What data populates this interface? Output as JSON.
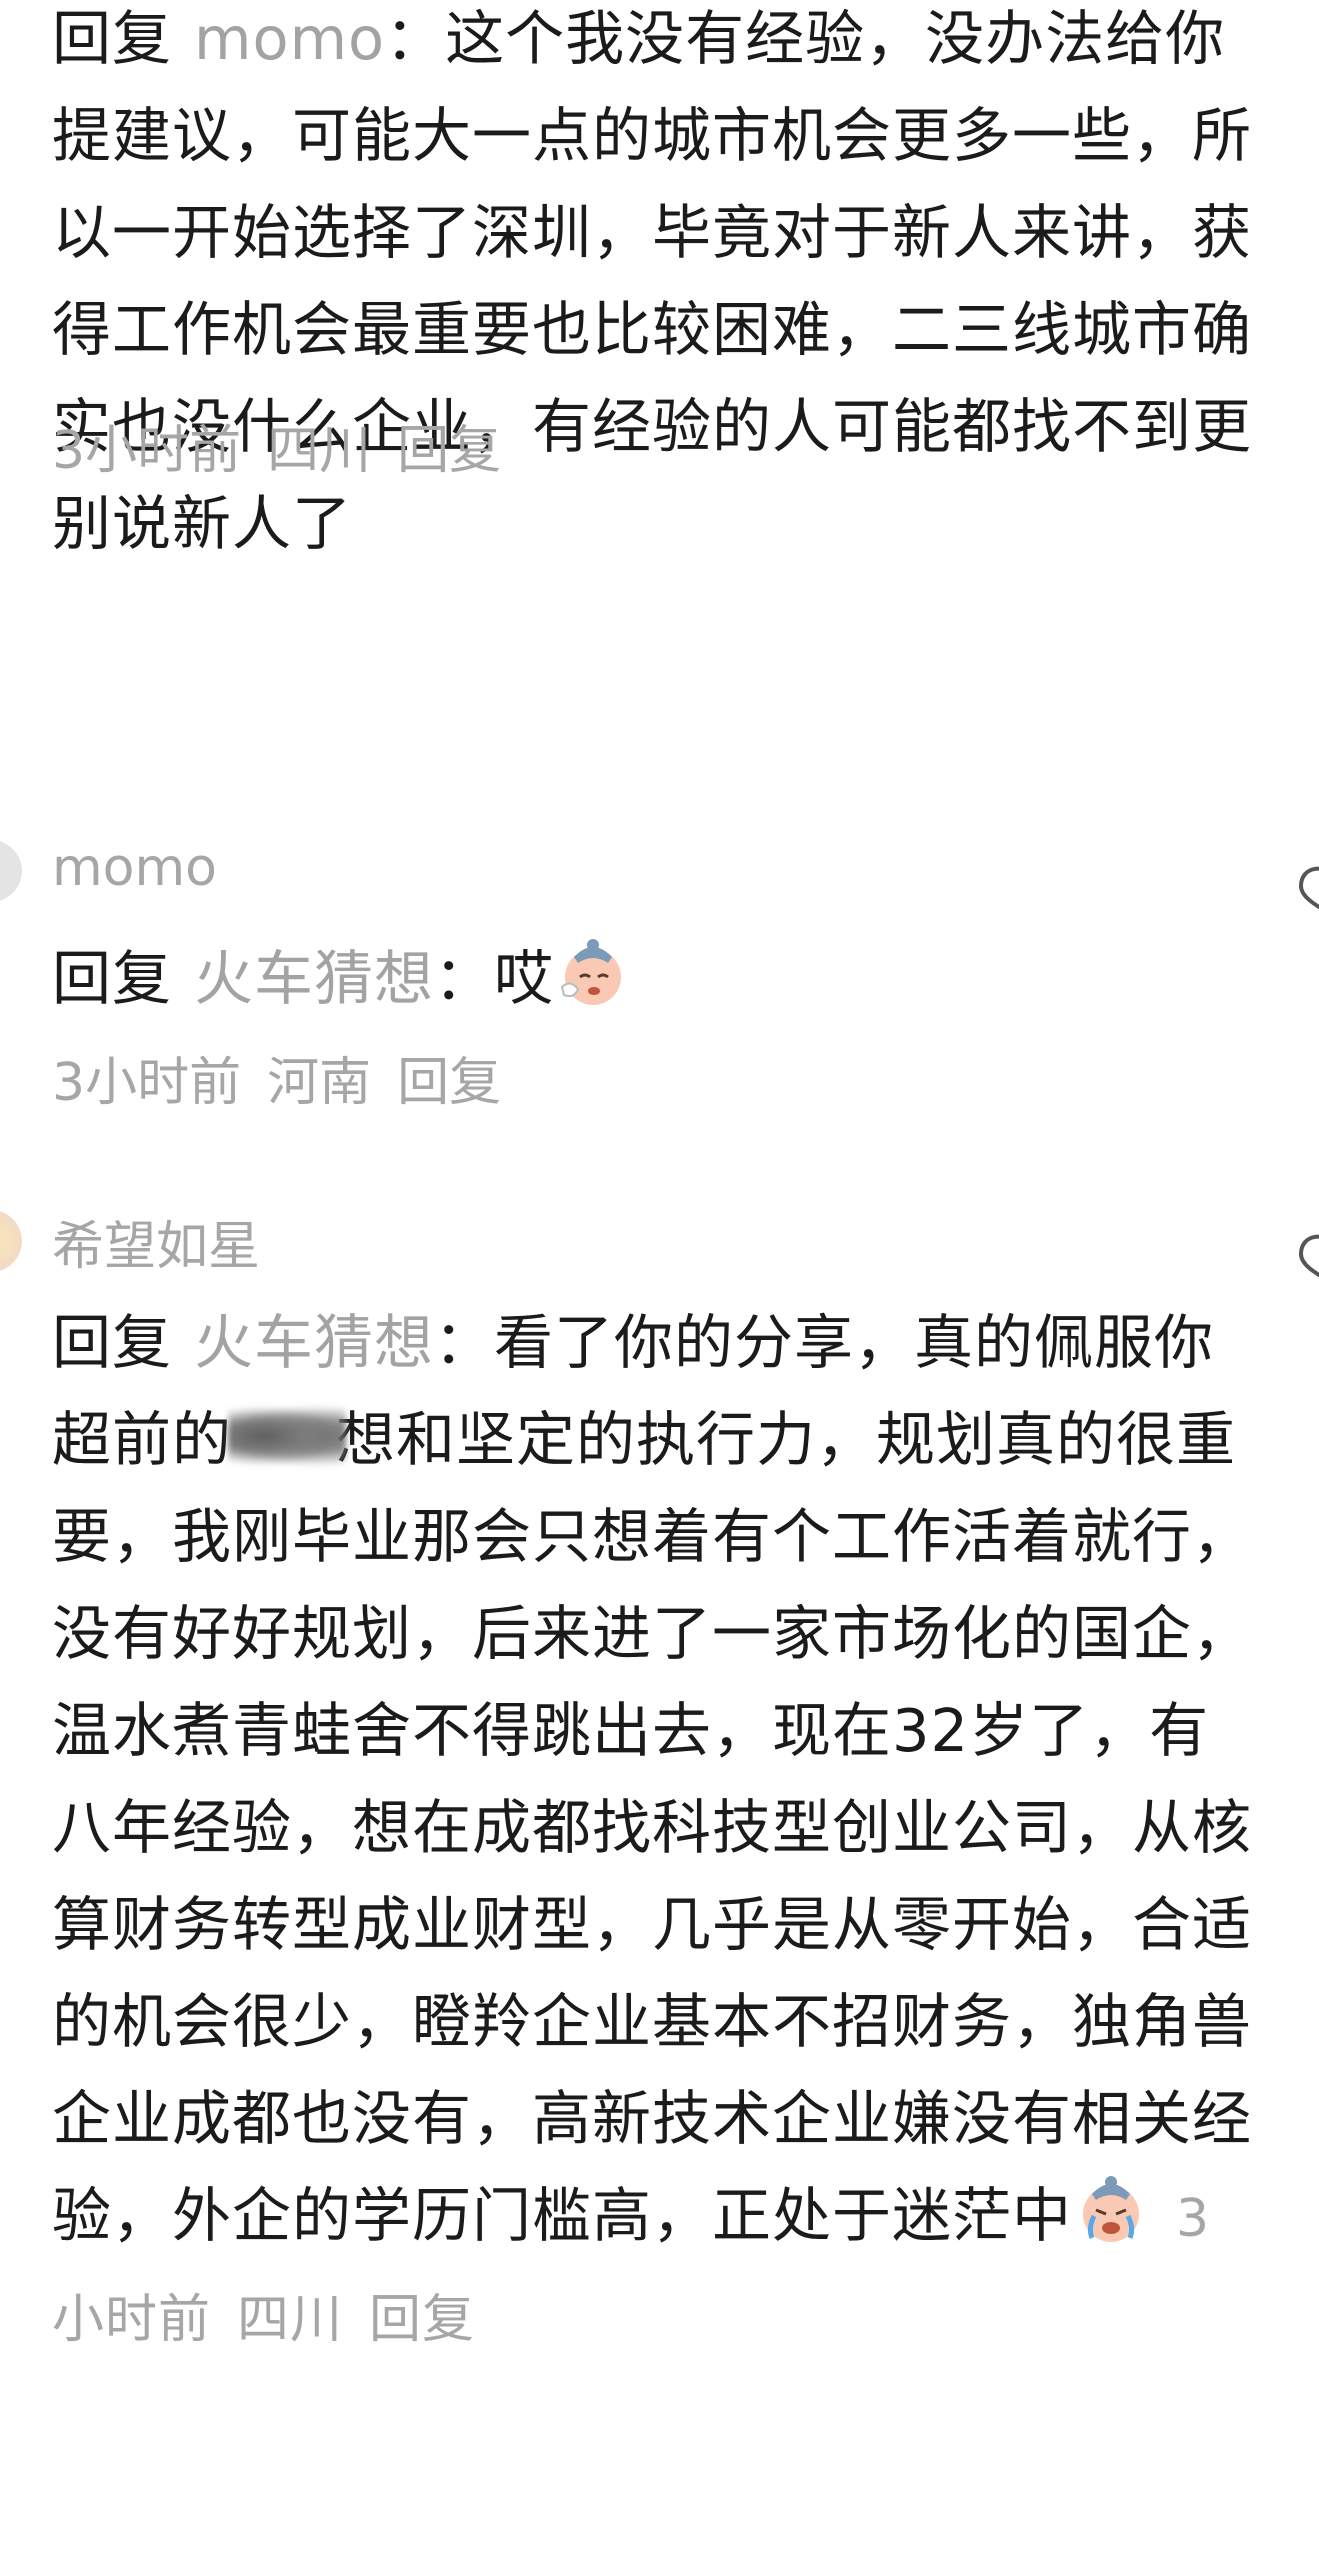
{
  "comments": [
    {
      "reply_word": "回复",
      "reply_to": "momo",
      "text": "：这个我没有经验，没办法给你提建议，可能大一点的城市机会更多一些，所以一开始选择了深圳，毕竟对于新人来讲，获得工作机会最重要也比较困难，二三线城市确实也没什么企业，有经验的人可能都找不到更别说新人了",
      "time": "3小时前",
      "location": "四川",
      "reply_label": "回复"
    },
    {
      "username": "momo",
      "reply_word": "回复",
      "reply_to": "火车猜想",
      "text": "：哎",
      "emoji": "crying-face-emoji",
      "time": "3小时前",
      "location": "河南",
      "reply_label": "回复"
    },
    {
      "username": "希望如星",
      "reply_word": "回复",
      "reply_to": "火车猜想",
      "text_a": "：看了你的分享，真的佩服你超前的",
      "text_b": "想和坚定的执行力，规划真的很重要，我刚毕业那会只想着有个工作活着就行，没有好好规划，后来进了一家市场化的国企，温水煮青蛙舍不得跳出去，现在32岁了，有八年经验，想在成都找科技型创业公司，从核算财务转型成业财型，几乎是从零开始，合适的机会很少，瞪羚企业基本不招财务，独角兽企业成都也没有，高新技术企业嫌没有相关经验，外企的学历门槛高，正处于迷茫中",
      "emoji": "crying-face-emoji",
      "time": "3小时前",
      "location": "四川",
      "reply_label": "回复"
    }
  ],
  "icons": {
    "like": "heart-outline-icon",
    "avatar": "user-avatar"
  },
  "colors": {
    "text": "#1b1b1b",
    "muted": "#a6a6a6"
  }
}
